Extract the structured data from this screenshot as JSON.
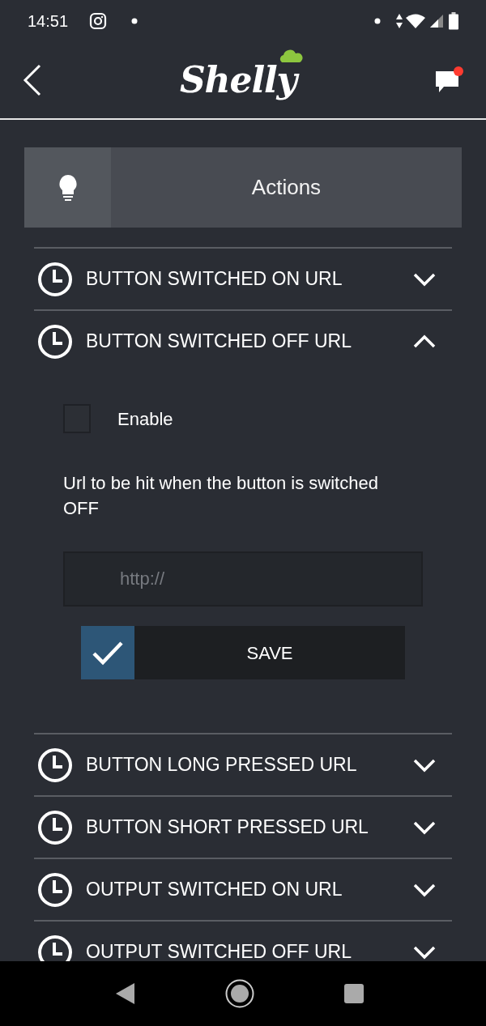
{
  "status_bar": {
    "time": "14:51"
  },
  "app_bar": {
    "logo": "Shelly",
    "has_notification": true
  },
  "header": {
    "title": "Actions"
  },
  "sections": [
    {
      "title": "BUTTON SWITCHED ON URL",
      "expanded": false
    },
    {
      "title": "BUTTON SWITCHED OFF URL",
      "expanded": true,
      "enable": {
        "label": "Enable",
        "checked": false
      },
      "description": "Url to be hit when the button is switched OFF",
      "url_field": {
        "placeholder": "http://"
      },
      "save_button": "SAVE"
    },
    {
      "title": "BUTTON LONG PRESSED URL",
      "expanded": false
    },
    {
      "title": "BUTTON SHORT PRESSED URL",
      "expanded": false
    },
    {
      "title": "OUTPUT SWITCHED ON URL",
      "expanded": false
    },
    {
      "title": "OUTPUT SWITCHED OFF URL",
      "expanded": false
    }
  ]
}
